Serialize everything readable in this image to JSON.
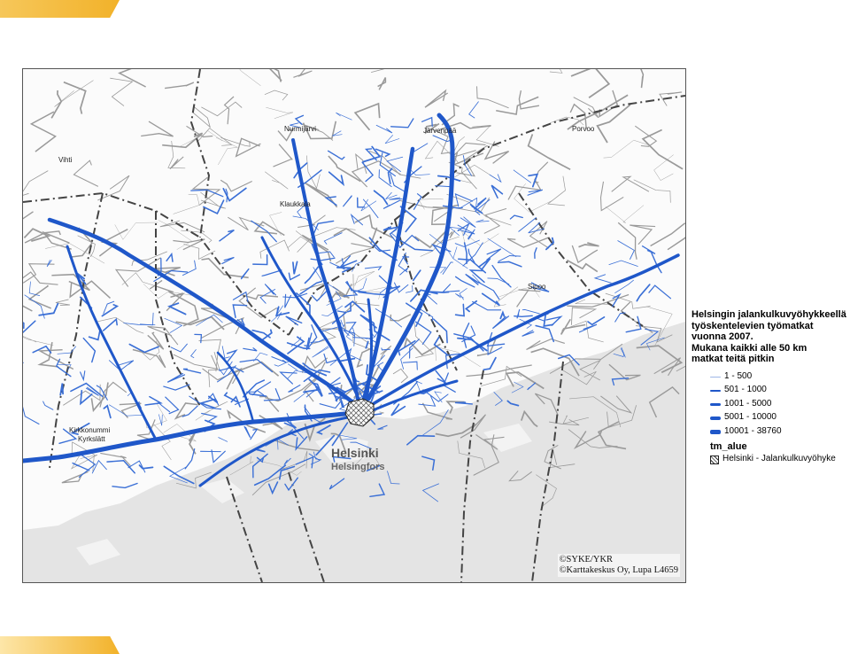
{
  "legend": {
    "title_lines": [
      "Helsingin jalankulkuvyöhykkeellä",
      "työskentelevien työmatkat",
      "vuonna 2007.",
      "Mukana  kaikki alle 50 km",
      "matkat teitä pitkin"
    ],
    "classes": [
      {
        "label": "1 - 500",
        "color": "#9fb7e6"
      },
      {
        "label": "501 - 1000",
        "color": "#1f57c9"
      },
      {
        "label": "1001 - 5000",
        "color": "#1f57c9"
      },
      {
        "label": "5001 - 10000",
        "color": "#1f57c9"
      },
      {
        "label": "10001 - 38760",
        "color": "#1f57c9"
      }
    ],
    "zone_heading": "tm_alue",
    "zone_label": "Helsinki - Jalankulkuvyöhyke"
  },
  "map": {
    "credit_lines": [
      "©SYKE/YKR",
      "©Karttakeskus Oy, Lupa L4659"
    ],
    "city_label": "Helsinki",
    "city_label_sv": "Helsingfors",
    "place_labels": [
      "Järvenpää",
      "Nurmijärvi",
      "Klaukkala",
      "Vihti",
      "Kirkkonummi",
      "Kyrkslätt",
      "Porvoo",
      "Sipoo"
    ],
    "route_color": "#1f57c9",
    "water_color": "#e4e4e4",
    "land_color": "#fbfbfb"
  }
}
